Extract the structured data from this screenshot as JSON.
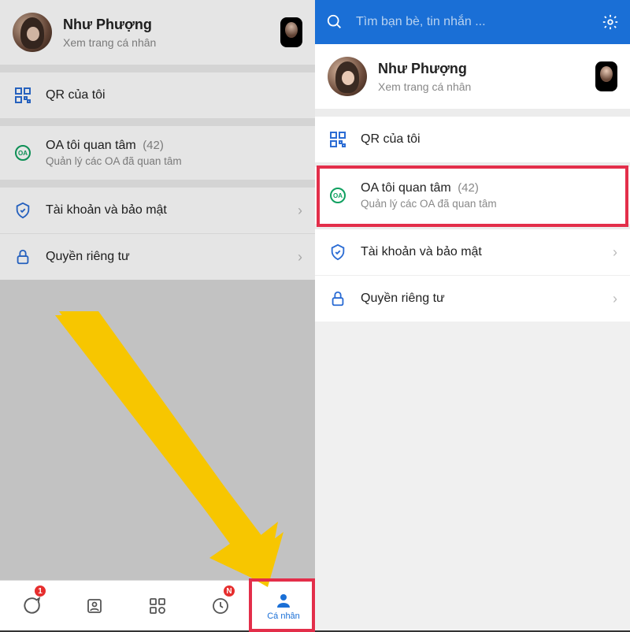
{
  "left": {
    "profile": {
      "name": "Như Phượng",
      "sub": "Xem trang cá nhân"
    },
    "qr": {
      "title": "QR của tôi"
    },
    "oa": {
      "title": "OA tôi quan tâm",
      "count": "(42)",
      "sub": "Quản lý các OA đã quan tâm"
    },
    "security": {
      "title": "Tài khoản và bảo mật"
    },
    "privacy": {
      "title": "Quyền riêng tư"
    },
    "nav": {
      "messages_badge": "1",
      "timeline_badge": "N",
      "profile_label": "Cá nhân"
    }
  },
  "right": {
    "search_placeholder": "Tìm bạn bè, tin nhắn ...",
    "profile": {
      "name": "Như Phượng",
      "sub": "Xem trang cá nhân"
    },
    "qr": {
      "title": "QR của tôi"
    },
    "oa": {
      "title": "OA tôi quan tâm",
      "count": "(42)",
      "sub": "Quản lý các OA đã quan tâm"
    },
    "security": {
      "title": "Tài khoản và bảo mật"
    },
    "privacy": {
      "title": "Quyền riêng tư"
    }
  }
}
